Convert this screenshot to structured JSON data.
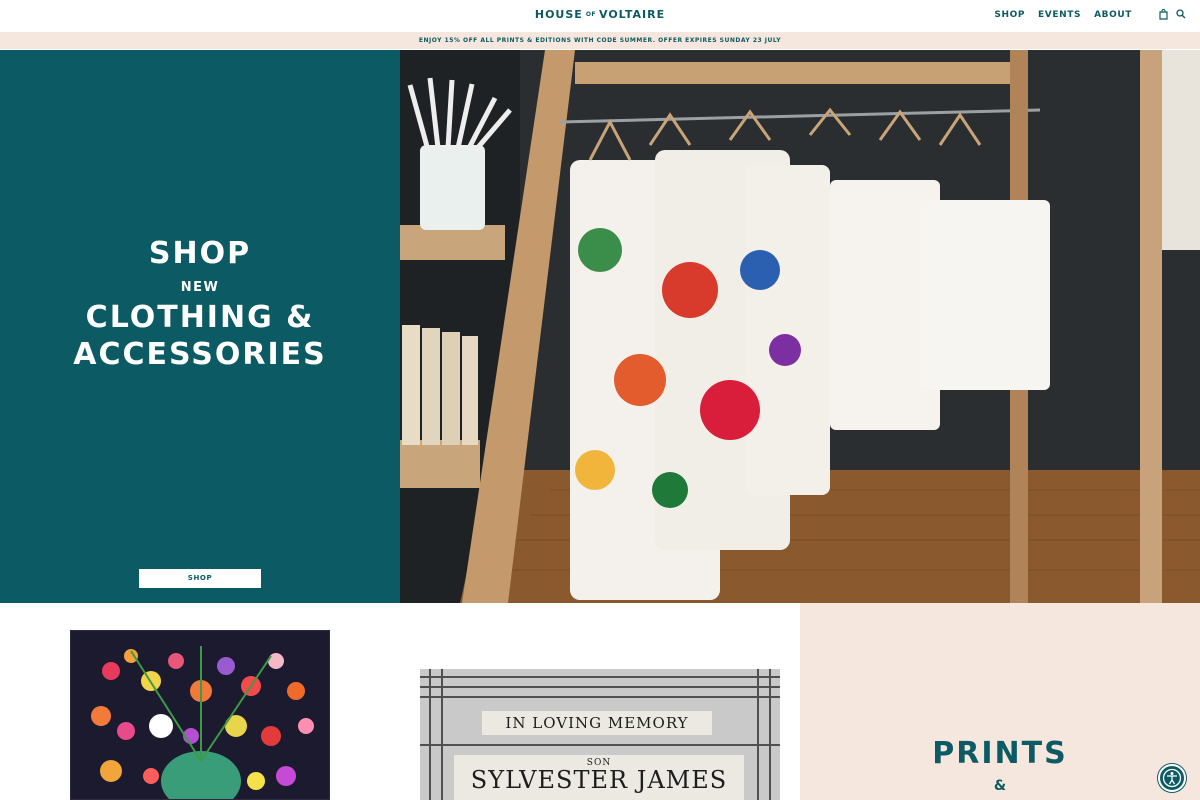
{
  "header": {
    "logo_part1": "HOUSE",
    "logo_of": "OF",
    "logo_part2": "VOLTAIRE",
    "nav": [
      {
        "label": "SHOP"
      },
      {
        "label": "EVENTS"
      },
      {
        "label": "ABOUT"
      }
    ],
    "icons": [
      "bag-icon",
      "search-icon"
    ]
  },
  "promo": {
    "text": "ENJOY 15% OFF ALL PRINTS & EDITIONS WITH CODE SUMMER. OFFER EXPIRES SUNDAY 23 JULY"
  },
  "hero": {
    "line1": "SHOP",
    "line2": "NEW",
    "line3": "CLOTHING &",
    "line4": "ACCESSORIES",
    "button_label": "SHOP"
  },
  "memory_art": {
    "plate1": "IN LOVING MEMORY",
    "plate2_small": "SON",
    "plate2_name": "SYLVESTER JAMES"
  },
  "prints": {
    "title": "PRINTS",
    "amp": "&"
  },
  "colors": {
    "brand_teal": "#0c5a63",
    "blush": "#f5e6de"
  }
}
